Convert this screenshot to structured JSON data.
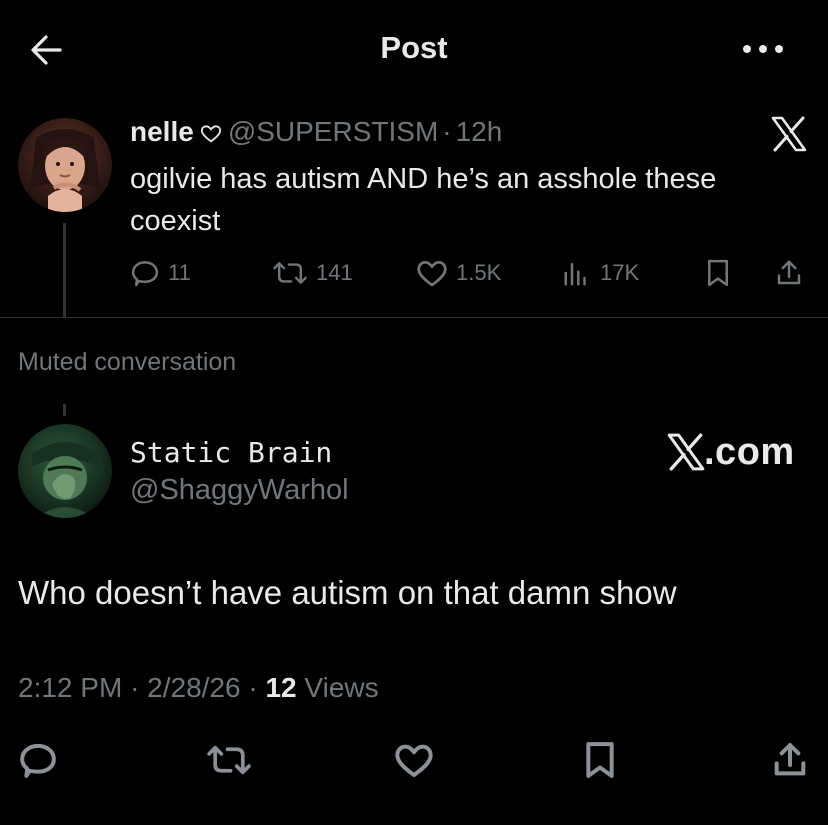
{
  "header": {
    "title": "Post",
    "back_icon": "arrow-left-icon",
    "more_icon": "more-dots-icon"
  },
  "quoted_post": {
    "display_name": "nelle",
    "handle": "@SUPERSTISM",
    "separator": "·",
    "time": "12h",
    "text": "ogilvie has autism AND he’s an asshole these coexist",
    "stats": {
      "replies": "11",
      "reposts": "141",
      "likes": "1.5K",
      "views": "17K"
    }
  },
  "muted_label": "Muted conversation",
  "main_post": {
    "display_name": "Static Brain",
    "handle": "@ShaggyWarhol",
    "watermark": "X.com",
    "text": "Who doesn’t have autism on that damn show",
    "time": "2:12 PM",
    "date": "2/28/26",
    "separator": "·",
    "views_count": "12",
    "views_label": "Views"
  },
  "colors": {
    "background": "#000000",
    "text_primary": "#e7e9ea",
    "text_secondary": "#71767b",
    "divider": "#2f3336"
  }
}
